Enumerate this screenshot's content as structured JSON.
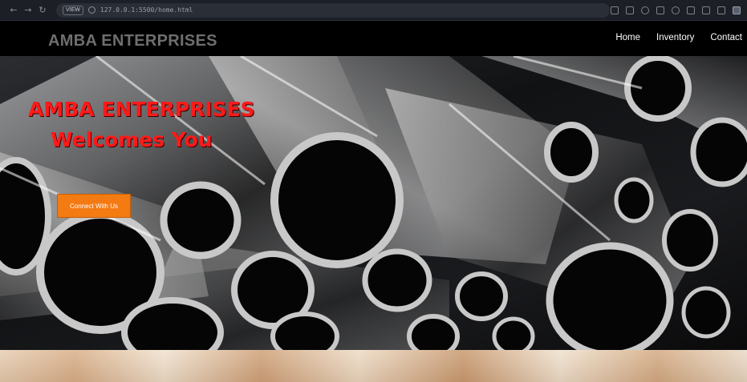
{
  "browser": {
    "back": "←",
    "forward": "→",
    "reload": "↻",
    "view_badge": "VIEW",
    "url": "127.0.0.1:5500/home.html"
  },
  "site": {
    "brand": "AMBA ENTERPRISES",
    "nav": [
      "Home",
      "Inventory",
      "Contact"
    ]
  },
  "hero": {
    "title_line1": "AMBA ENTERPRISES",
    "title_line2": "Welcomes You",
    "cta_label": "Connect With Us"
  },
  "colors": {
    "accent": "#f47a12",
    "title": "#ff1a1a",
    "header_bg": "#000000",
    "brand_text": "#6e6e6e"
  }
}
